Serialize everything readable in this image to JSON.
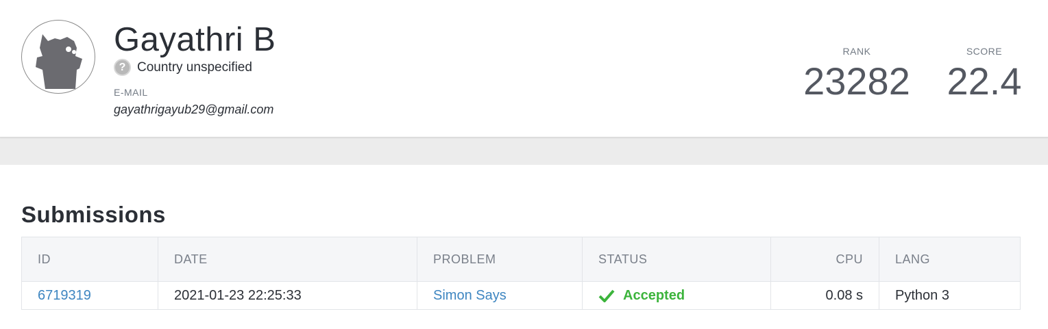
{
  "profile": {
    "name": "Gayathri B",
    "country": "Country unspecified",
    "country_icon": "question-mark-icon",
    "email_label": "E-MAIL",
    "email": "gayathrigayub29@gmail.com",
    "avatar_icon": "default-cat-avatar-icon",
    "rank_label": "RANK",
    "rank_value": "23282",
    "score_label": "SCORE",
    "score_value": "22.4"
  },
  "submissions": {
    "title": "Submissions",
    "columns": [
      "ID",
      "DATE",
      "PROBLEM",
      "STATUS",
      "CPU",
      "LANG"
    ],
    "rows": [
      {
        "id": "6719319",
        "date": "2021-01-23 22:25:33",
        "problem": "Simon Says",
        "status": "Accepted",
        "status_icon": "checkmark-icon",
        "cpu": "0.08 s",
        "lang": "Python 3"
      }
    ]
  },
  "colors": {
    "link": "#3e86c1",
    "accepted": "#3cb43c",
    "page_bg": "#ececec"
  }
}
